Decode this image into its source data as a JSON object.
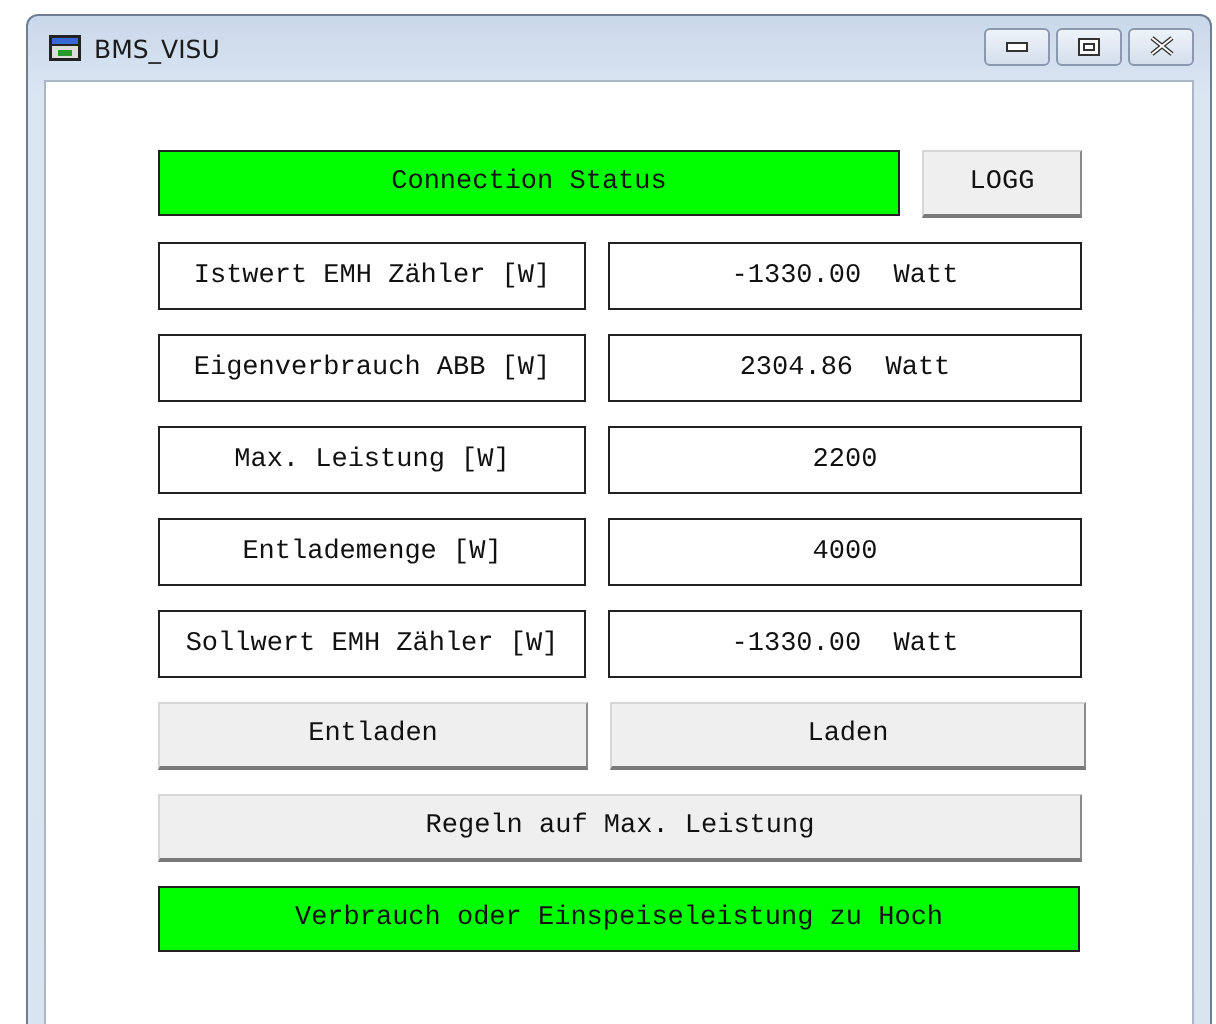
{
  "window": {
    "title": "BMS_VISU"
  },
  "connection_status": {
    "text": "Connection Status",
    "active": true
  },
  "logg_button": "LOGG",
  "readings": [
    {
      "label": "Istwert EMH Zähler [W]",
      "value": "-1330.00  Watt"
    },
    {
      "label": "Eigenverbrauch ABB [W]",
      "value": "2304.86  Watt"
    },
    {
      "label": "Max. Leistung [W]",
      "value": "2200"
    },
    {
      "label": "Entlademenge [W]",
      "value": "4000"
    },
    {
      "label": "Sollwert EMH Zähler [W]",
      "value": "-1330.00  Watt"
    }
  ],
  "buttons": [
    "Entladen",
    "Laden"
  ],
  "regulate_button": "Regeln auf Max. Leistung",
  "alarm": {
    "text": "Verbrauch oder Einspeiseleistung zu Hoch",
    "active": true
  }
}
